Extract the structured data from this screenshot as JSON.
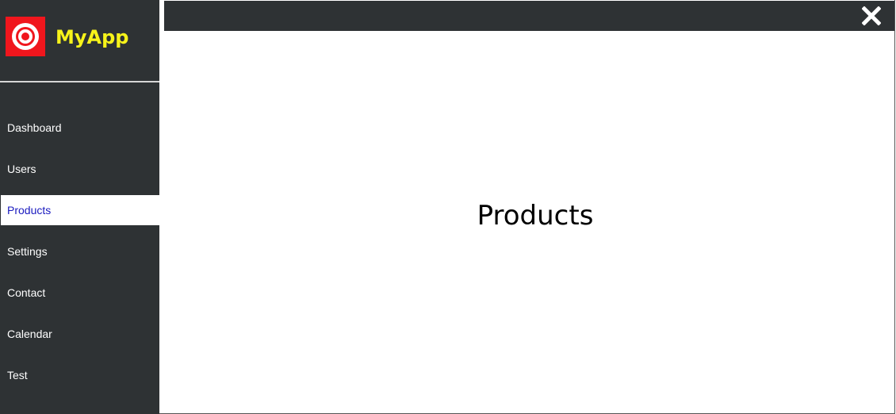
{
  "brand": {
    "name": "MyApp",
    "logo_icon": "target-icon"
  },
  "sidebar": {
    "items": [
      {
        "label": "Dashboard",
        "active": false
      },
      {
        "label": "Users",
        "active": false
      },
      {
        "label": "Products",
        "active": true
      },
      {
        "label": "Settings",
        "active": false
      },
      {
        "label": "Contact",
        "active": false
      },
      {
        "label": "Calendar",
        "active": false
      },
      {
        "label": "Test",
        "active": false
      }
    ]
  },
  "topbar": {
    "close_icon": "close-icon"
  },
  "main": {
    "title": "Products"
  },
  "colors": {
    "sidebar_bg": "#2e3234",
    "brand_text": "#f7f31a",
    "logo_bg": "#f0161d",
    "active_text": "#1a1abf"
  }
}
